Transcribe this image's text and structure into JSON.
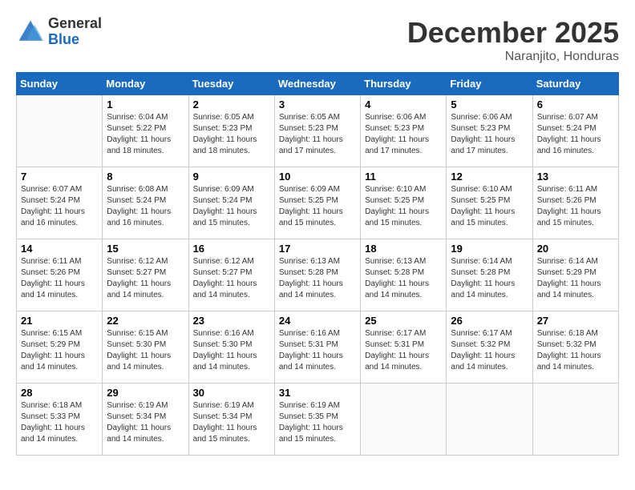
{
  "header": {
    "logo_general": "General",
    "logo_blue": "Blue",
    "month_title": "December 2025",
    "location": "Naranjito, Honduras"
  },
  "days_of_week": [
    "Sunday",
    "Monday",
    "Tuesday",
    "Wednesday",
    "Thursday",
    "Friday",
    "Saturday"
  ],
  "weeks": [
    [
      {
        "day": "",
        "sunrise": "",
        "sunset": "",
        "daylight": ""
      },
      {
        "day": "1",
        "sunrise": "Sunrise: 6:04 AM",
        "sunset": "Sunset: 5:22 PM",
        "daylight": "Daylight: 11 hours and 18 minutes."
      },
      {
        "day": "2",
        "sunrise": "Sunrise: 6:05 AM",
        "sunset": "Sunset: 5:23 PM",
        "daylight": "Daylight: 11 hours and 18 minutes."
      },
      {
        "day": "3",
        "sunrise": "Sunrise: 6:05 AM",
        "sunset": "Sunset: 5:23 PM",
        "daylight": "Daylight: 11 hours and 17 minutes."
      },
      {
        "day": "4",
        "sunrise": "Sunrise: 6:06 AM",
        "sunset": "Sunset: 5:23 PM",
        "daylight": "Daylight: 11 hours and 17 minutes."
      },
      {
        "day": "5",
        "sunrise": "Sunrise: 6:06 AM",
        "sunset": "Sunset: 5:23 PM",
        "daylight": "Daylight: 11 hours and 17 minutes."
      },
      {
        "day": "6",
        "sunrise": "Sunrise: 6:07 AM",
        "sunset": "Sunset: 5:24 PM",
        "daylight": "Daylight: 11 hours and 16 minutes."
      }
    ],
    [
      {
        "day": "7",
        "sunrise": "Sunrise: 6:07 AM",
        "sunset": "Sunset: 5:24 PM",
        "daylight": "Daylight: 11 hours and 16 minutes."
      },
      {
        "day": "8",
        "sunrise": "Sunrise: 6:08 AM",
        "sunset": "Sunset: 5:24 PM",
        "daylight": "Daylight: 11 hours and 16 minutes."
      },
      {
        "day": "9",
        "sunrise": "Sunrise: 6:09 AM",
        "sunset": "Sunset: 5:24 PM",
        "daylight": "Daylight: 11 hours and 15 minutes."
      },
      {
        "day": "10",
        "sunrise": "Sunrise: 6:09 AM",
        "sunset": "Sunset: 5:25 PM",
        "daylight": "Daylight: 11 hours and 15 minutes."
      },
      {
        "day": "11",
        "sunrise": "Sunrise: 6:10 AM",
        "sunset": "Sunset: 5:25 PM",
        "daylight": "Daylight: 11 hours and 15 minutes."
      },
      {
        "day": "12",
        "sunrise": "Sunrise: 6:10 AM",
        "sunset": "Sunset: 5:25 PM",
        "daylight": "Daylight: 11 hours and 15 minutes."
      },
      {
        "day": "13",
        "sunrise": "Sunrise: 6:11 AM",
        "sunset": "Sunset: 5:26 PM",
        "daylight": "Daylight: 11 hours and 15 minutes."
      }
    ],
    [
      {
        "day": "14",
        "sunrise": "Sunrise: 6:11 AM",
        "sunset": "Sunset: 5:26 PM",
        "daylight": "Daylight: 11 hours and 14 minutes."
      },
      {
        "day": "15",
        "sunrise": "Sunrise: 6:12 AM",
        "sunset": "Sunset: 5:27 PM",
        "daylight": "Daylight: 11 hours and 14 minutes."
      },
      {
        "day": "16",
        "sunrise": "Sunrise: 6:12 AM",
        "sunset": "Sunset: 5:27 PM",
        "daylight": "Daylight: 11 hours and 14 minutes."
      },
      {
        "day": "17",
        "sunrise": "Sunrise: 6:13 AM",
        "sunset": "Sunset: 5:28 PM",
        "daylight": "Daylight: 11 hours and 14 minutes."
      },
      {
        "day": "18",
        "sunrise": "Sunrise: 6:13 AM",
        "sunset": "Sunset: 5:28 PM",
        "daylight": "Daylight: 11 hours and 14 minutes."
      },
      {
        "day": "19",
        "sunrise": "Sunrise: 6:14 AM",
        "sunset": "Sunset: 5:28 PM",
        "daylight": "Daylight: 11 hours and 14 minutes."
      },
      {
        "day": "20",
        "sunrise": "Sunrise: 6:14 AM",
        "sunset": "Sunset: 5:29 PM",
        "daylight": "Daylight: 11 hours and 14 minutes."
      }
    ],
    [
      {
        "day": "21",
        "sunrise": "Sunrise: 6:15 AM",
        "sunset": "Sunset: 5:29 PM",
        "daylight": "Daylight: 11 hours and 14 minutes."
      },
      {
        "day": "22",
        "sunrise": "Sunrise: 6:15 AM",
        "sunset": "Sunset: 5:30 PM",
        "daylight": "Daylight: 11 hours and 14 minutes."
      },
      {
        "day": "23",
        "sunrise": "Sunrise: 6:16 AM",
        "sunset": "Sunset: 5:30 PM",
        "daylight": "Daylight: 11 hours and 14 minutes."
      },
      {
        "day": "24",
        "sunrise": "Sunrise: 6:16 AM",
        "sunset": "Sunset: 5:31 PM",
        "daylight": "Daylight: 11 hours and 14 minutes."
      },
      {
        "day": "25",
        "sunrise": "Sunrise: 6:17 AM",
        "sunset": "Sunset: 5:31 PM",
        "daylight": "Daylight: 11 hours and 14 minutes."
      },
      {
        "day": "26",
        "sunrise": "Sunrise: 6:17 AM",
        "sunset": "Sunset: 5:32 PM",
        "daylight": "Daylight: 11 hours and 14 minutes."
      },
      {
        "day": "27",
        "sunrise": "Sunrise: 6:18 AM",
        "sunset": "Sunset: 5:32 PM",
        "daylight": "Daylight: 11 hours and 14 minutes."
      }
    ],
    [
      {
        "day": "28",
        "sunrise": "Sunrise: 6:18 AM",
        "sunset": "Sunset: 5:33 PM",
        "daylight": "Daylight: 11 hours and 14 minutes."
      },
      {
        "day": "29",
        "sunrise": "Sunrise: 6:19 AM",
        "sunset": "Sunset: 5:34 PM",
        "daylight": "Daylight: 11 hours and 14 minutes."
      },
      {
        "day": "30",
        "sunrise": "Sunrise: 6:19 AM",
        "sunset": "Sunset: 5:34 PM",
        "daylight": "Daylight: 11 hours and 15 minutes."
      },
      {
        "day": "31",
        "sunrise": "Sunrise: 6:19 AM",
        "sunset": "Sunset: 5:35 PM",
        "daylight": "Daylight: 11 hours and 15 minutes."
      },
      {
        "day": "",
        "sunrise": "",
        "sunset": "",
        "daylight": ""
      },
      {
        "day": "",
        "sunrise": "",
        "sunset": "",
        "daylight": ""
      },
      {
        "day": "",
        "sunrise": "",
        "sunset": "",
        "daylight": ""
      }
    ]
  ]
}
